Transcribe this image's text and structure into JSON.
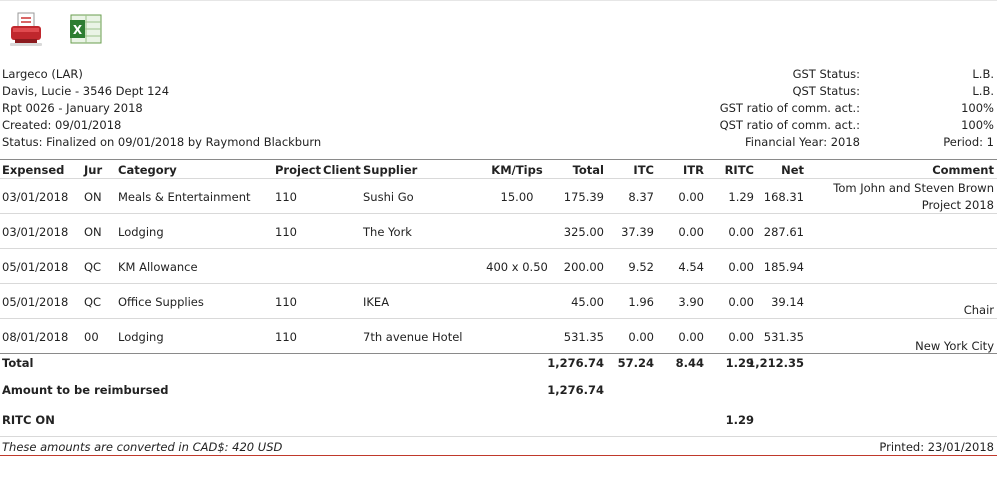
{
  "toolbar": {
    "print_icon": "printer-icon",
    "excel_icon": "excel-icon"
  },
  "header_left": [
    "Largeco (LAR)",
    "Davis, Lucie - 3546 Dept 124",
    "Rpt 0026 - January 2018",
    "Created: 09/01/2018",
    "Status: Finalized on 09/01/2018 by Raymond Blackburn"
  ],
  "header_right": [
    {
      "label": "GST Status:",
      "value": "L.B."
    },
    {
      "label": "QST Status:",
      "value": "L.B."
    },
    {
      "label": "GST ratio of comm. act.:",
      "value": "100%"
    },
    {
      "label": "QST ratio of comm. act.:",
      "value": "100%"
    },
    {
      "label": "Financial Year: 2018",
      "value": "Period: 1"
    }
  ],
  "columns": {
    "expensed": "Expensed",
    "jur": "Jur",
    "category": "Category",
    "project": "Project",
    "client": "Client",
    "supplier": "Supplier",
    "km": "KM/Tips",
    "total": "Total",
    "itc": "ITC",
    "itr": "ITR",
    "ritc": "RITC",
    "net": "Net",
    "comment": "Comment"
  },
  "rows": [
    {
      "expensed": "03/01/2018",
      "jur": "ON",
      "category": "Meals & Entertainment",
      "project": "110",
      "client": "",
      "supplier": "Sushi Go",
      "km": "15.00",
      "total": "175.39",
      "itc": "8.37",
      "itr": "0.00",
      "ritc": "1.29",
      "net": "168.31",
      "comment1": "Tom John and Steven Brown",
      "comment2": "Project 2018"
    },
    {
      "expensed": "03/01/2018",
      "jur": "ON",
      "category": "Lodging",
      "project": "110",
      "client": "",
      "supplier": "The York",
      "km": "",
      "total": "325.00",
      "itc": "37.39",
      "itr": "0.00",
      "ritc": "0.00",
      "net": "287.61",
      "comment1": "",
      "comment2": ""
    },
    {
      "expensed": "05/01/2018",
      "jur": "QC",
      "category": "KM Allowance",
      "project": "",
      "client": "",
      "supplier": "",
      "km": "400 x 0.50",
      "total": "200.00",
      "itc": "9.52",
      "itr": "4.54",
      "ritc": "0.00",
      "net": "185.94",
      "comment1": "",
      "comment2": ""
    },
    {
      "expensed": "05/01/2018",
      "jur": "QC",
      "category": "Office Supplies",
      "project": "110",
      "client": "",
      "supplier": "IKEA",
      "km": "",
      "total": "45.00",
      "itc": "1.96",
      "itr": "3.90",
      "ritc": "0.00",
      "net": "39.14",
      "comment1": "",
      "comment2": "Chair"
    },
    {
      "expensed": "08/01/2018",
      "jur": "00",
      "category": "Lodging",
      "project": "110",
      "client": "",
      "supplier": "7th avenue Hotel",
      "km": "",
      "total": "531.35",
      "itc": "0.00",
      "itr": "0.00",
      "ritc": "0.00",
      "net": "531.35",
      "comment1": "",
      "comment2": "New York City"
    }
  ],
  "totals": {
    "label": "Total",
    "total": "1,276.74",
    "itc": "57.24",
    "itr": "8.44",
    "ritc": "1.29",
    "net": "1,212.35"
  },
  "reimbursed": {
    "label": "Amount to be reimbursed",
    "value": "1,276.74"
  },
  "ritc_on": {
    "label": "RITC ON",
    "value": "1.29"
  },
  "footer": {
    "note": "These amounts are converted in CAD$: 420 USD",
    "printed": "Printed: 23/01/2018"
  }
}
